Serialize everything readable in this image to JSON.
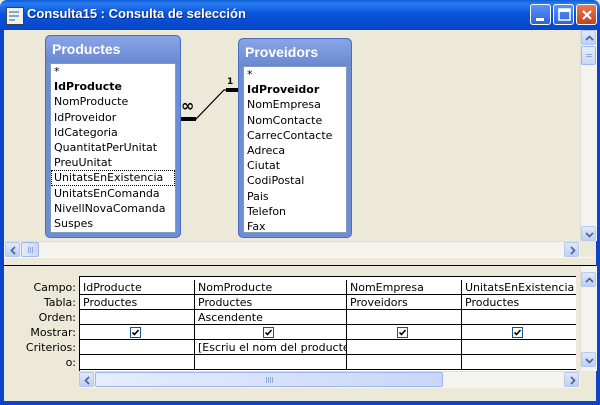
{
  "window": {
    "title": "Consulta15 : Consulta de selección"
  },
  "tables": [
    {
      "name": "Productes",
      "fields": [
        {
          "label": "*",
          "key": false
        },
        {
          "label": "IdProducte",
          "key": true
        },
        {
          "label": "NomProducte",
          "key": false
        },
        {
          "label": "IdProveidor",
          "key": false
        },
        {
          "label": "IdCategoria",
          "key": false
        },
        {
          "label": "QuantitatPerUnitat",
          "key": false
        },
        {
          "label": "PreuUnitat",
          "key": false
        },
        {
          "label": "UnitatsEnExistencia",
          "key": false,
          "selected": true
        },
        {
          "label": "UnitatsEnComanda",
          "key": false
        },
        {
          "label": "NivellNovaComanda",
          "key": false
        },
        {
          "label": "Suspes",
          "key": false
        }
      ]
    },
    {
      "name": "Proveidors",
      "fields": [
        {
          "label": "*",
          "key": false
        },
        {
          "label": "IdProveidor",
          "key": true
        },
        {
          "label": "NomEmpresa",
          "key": false
        },
        {
          "label": "NomContacte",
          "key": false
        },
        {
          "label": "CarrecContacte",
          "key": false
        },
        {
          "label": "Adreca",
          "key": false
        },
        {
          "label": "Ciutat",
          "key": false
        },
        {
          "label": "CodiPostal",
          "key": false
        },
        {
          "label": "Pais",
          "key": false
        },
        {
          "label": "Telefon",
          "key": false
        },
        {
          "label": "Fax",
          "key": false
        }
      ]
    }
  ],
  "relationship": {
    "one_label": "1",
    "many_label": "∞"
  },
  "grid": {
    "row_labels": [
      "Campo:",
      "Tabla:",
      "Orden:",
      "Mostrar:",
      "Criterios:",
      "o:"
    ],
    "columns": [
      {
        "campo": "IdProducte",
        "tabla": "Productes",
        "orden": "",
        "mostrar": true,
        "criterios": "",
        "o": ""
      },
      {
        "campo": "NomProducte",
        "tabla": "Productes",
        "orden": "Ascendente",
        "mostrar": true,
        "criterios": "[Escriu el nom del producte:]",
        "o": ""
      },
      {
        "campo": "NomEmpresa",
        "tabla": "Proveidors",
        "orden": "",
        "mostrar": true,
        "criterios": "",
        "o": ""
      },
      {
        "campo": "UnitatsEnExistencia",
        "tabla": "Productes",
        "orden": "",
        "mostrar": true,
        "criterios": "",
        "o": ""
      }
    ]
  },
  "colors": {
    "titlebar": "#0855dd",
    "table_window": "#6f8dd5",
    "pane_background": "#ece9d8"
  }
}
